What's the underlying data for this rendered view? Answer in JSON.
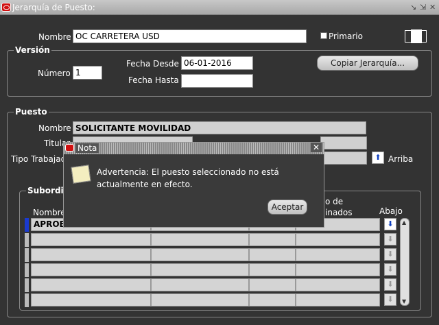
{
  "window": {
    "title": "Jerarquía de Puesto:",
    "controls": [
      "↘",
      "⇲",
      "✕"
    ]
  },
  "header": {
    "nombre_label": "Nombre",
    "nombre_value": "OC CARRETERA USD",
    "primario_label": "Primario"
  },
  "version": {
    "section_title": "Versión",
    "numero_label": "Número",
    "numero_value": "1",
    "fecha_desde_label": "Fecha Desde",
    "fecha_desde_value": "06-01-2016",
    "fecha_hasta_label": "Fecha Hasta",
    "fecha_hasta_value": "",
    "copy_button": "Copiar Jerarquía..."
  },
  "puesto": {
    "section_title": "Puesto",
    "nombre_label": "Nombre",
    "nombre_value": "SOLICITANTE MOVILIDAD",
    "titular_label": "Titular",
    "tipo_label": "Tipo Trabajado",
    "arriba_label": "Arriba"
  },
  "subordinados": {
    "section_title": "Subordin",
    "col_nombre": "Nombre",
    "col_num_1": "o de",
    "col_num_2": "inados",
    "col_abajo": "Abajo",
    "rows": [
      "APROBA",
      "",
      "",
      "",
      "",
      ""
    ]
  },
  "dialog": {
    "title": "Nota",
    "message": "Advertencia: El puesto seleccionado no está actualmente en efecto.",
    "ok_button": "Aceptar"
  },
  "colors": {
    "accent": "#d01010",
    "arrow": "#1040c0",
    "background": "#333333"
  }
}
